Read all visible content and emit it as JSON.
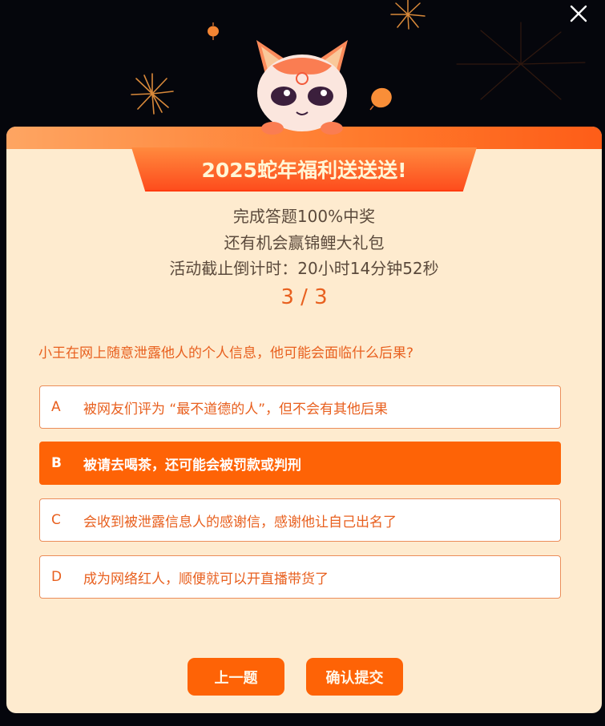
{
  "header": {
    "close_icon": "close-icon"
  },
  "mascot": {
    "icon": "cat-mascot"
  },
  "title": "2025蛇年福利送送送!",
  "info": {
    "line1": "完成答题100%中奖",
    "line2": "还有机会赢锦鲤大礼包",
    "line3": "活动截止倒计时：20小时14分钟52秒"
  },
  "progress": "3 / 3",
  "question": "小王在网上随意泄露他人的个人信息，他可能会面临什么后果?",
  "options": [
    {
      "letter": "A",
      "text": "被网友们评为 “最不道德的人”，但不会有其他后果",
      "selected": false
    },
    {
      "letter": "B",
      "text": "被请去喝茶，还可能会被罚款或判刑",
      "selected": true
    },
    {
      "letter": "C",
      "text": "会收到被泄露信息人的感谢信，感谢他让自己出名了",
      "selected": false
    },
    {
      "letter": "D",
      "text": "成为网络红人，顺便就可以开直播带货了",
      "selected": false
    }
  ],
  "buttons": {
    "prev": "上一题",
    "submit": "确认提交"
  },
  "colors": {
    "accent": "#fe6306",
    "panel_bg": "#feebcf",
    "text_orange": "#e8601f",
    "page_bg": "#05060c"
  }
}
